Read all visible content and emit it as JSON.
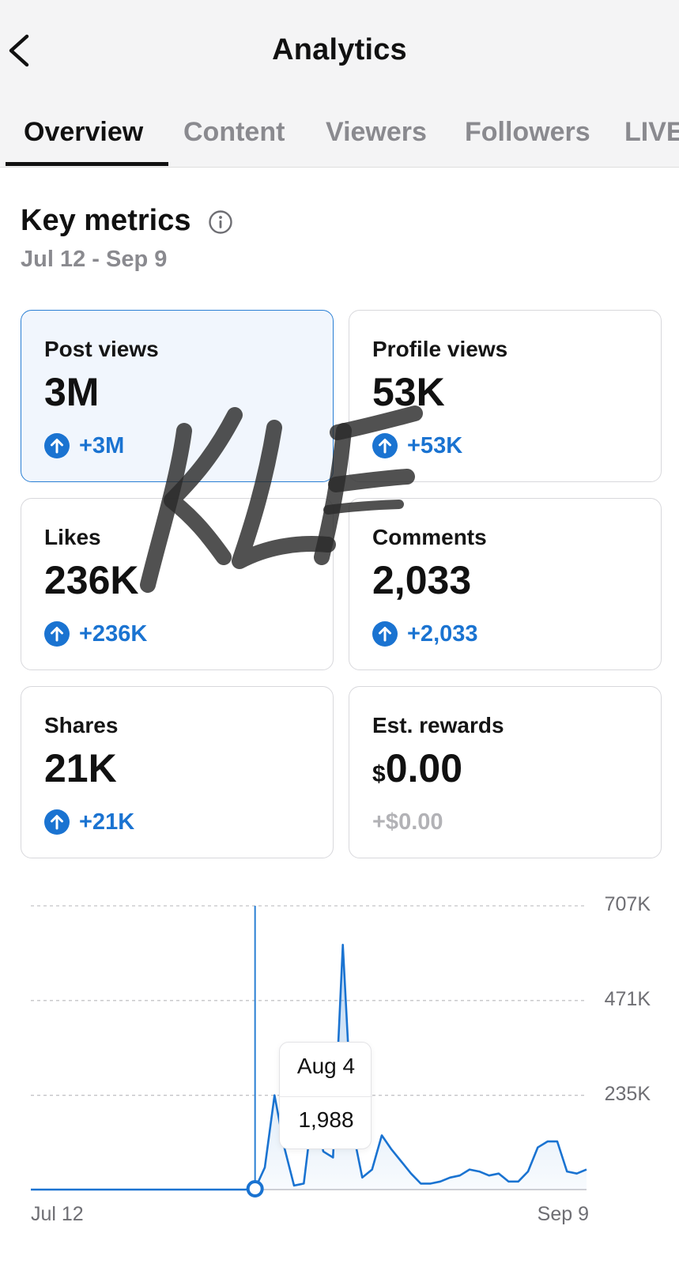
{
  "header": {
    "title": "Analytics",
    "back_icon": "chevron-left-icon"
  },
  "tabs": [
    {
      "label": "Overview",
      "active": true
    },
    {
      "label": "Content",
      "active": false
    },
    {
      "label": "Viewers",
      "active": false
    },
    {
      "label": "Followers",
      "active": false
    },
    {
      "label": "LIVE",
      "active": false
    }
  ],
  "key_metrics": {
    "title": "Key metrics",
    "info_icon": "info-icon",
    "date_range": "Jul 12 - Sep 9"
  },
  "metrics": [
    {
      "label": "Post views",
      "value": "3M",
      "delta": "+3M",
      "selected": true,
      "trend": "up"
    },
    {
      "label": "Profile views",
      "value": "53K",
      "delta": "+53K",
      "selected": false,
      "trend": "up"
    },
    {
      "label": "Likes",
      "value": "236K",
      "delta": "+236K",
      "selected": false,
      "trend": "up"
    },
    {
      "label": "Comments",
      "value": "2,033",
      "delta": "+2,033",
      "selected": false,
      "trend": "up"
    },
    {
      "label": "Shares",
      "value": "21K",
      "delta": "+21K",
      "selected": false,
      "trend": "up"
    },
    {
      "label": "Est. rewards",
      "currency": "$",
      "value": "0.00",
      "delta": "+$0.00",
      "selected": false,
      "trend": "none"
    }
  ],
  "watermark": "KLF",
  "colors": {
    "accent": "#1a73d1",
    "selected_card_bg": "#f1f6fd",
    "selected_card_border": "#2a7fd4",
    "muted": "#8a8a8f"
  },
  "chart_data": {
    "type": "area",
    "series": [
      {
        "values": [
          0,
          0,
          0,
          0,
          0,
          0,
          0,
          0,
          0,
          0,
          0,
          0,
          0,
          0,
          0,
          0,
          0,
          0,
          0,
          0,
          0,
          0,
          0,
          1988,
          55000,
          235000,
          105000,
          10000,
          15000,
          215000,
          95000,
          80000,
          610000,
          150000,
          30000,
          50000,
          135000,
          100000,
          70000,
          40000,
          15000,
          15000,
          20000,
          30000,
          35000,
          50000,
          45000,
          35000,
          40000,
          20000,
          20000,
          45000,
          105000,
          120000,
          120000,
          45000,
          40000,
          50000
        ]
      }
    ],
    "x_start_label": "Jul 12",
    "x_end_label": "Sep 9",
    "y_ticks": [
      "707K",
      "471K",
      "235K"
    ],
    "y_tick_values": [
      707000,
      471000,
      235000
    ],
    "ylim": [
      0,
      707000
    ],
    "grid": true,
    "tooltip": {
      "date": "Aug 4",
      "value": "1,988"
    },
    "selected_index": 23
  }
}
